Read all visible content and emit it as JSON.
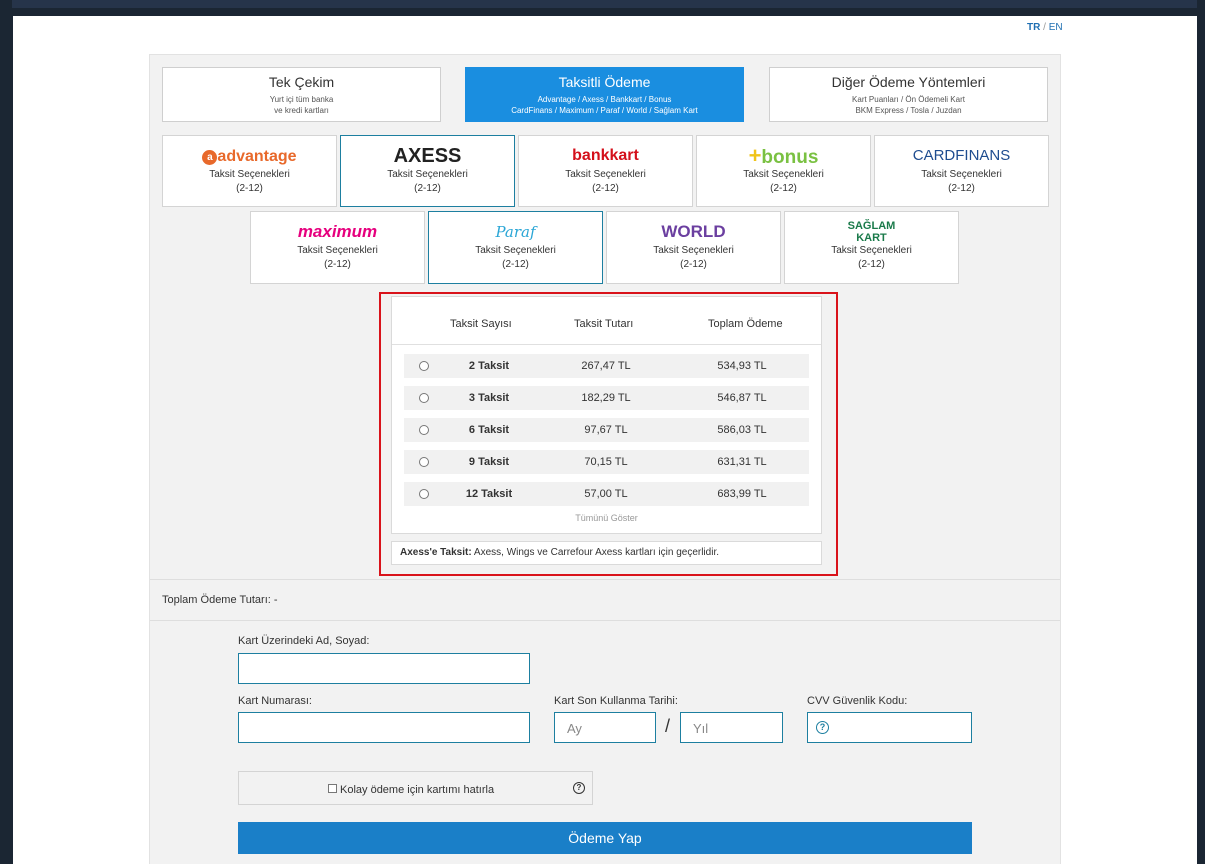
{
  "language": {
    "tr": "TR",
    "separator": "/",
    "en": "EN"
  },
  "tabs": [
    {
      "title": "Tek Çekim",
      "sub1": "Yurt içi tüm banka",
      "sub2": "ve kredi kartları"
    },
    {
      "title": "Taksitli Ödeme",
      "sub1": "Advantage / Axess / Bankkart / Bonus",
      "sub2": "CardFinans / Maximum / Paraf / World / Sağlam Kart"
    },
    {
      "title": "Diğer Ödeme Yöntemleri",
      "sub1": "Kart Puanları / Ön Ödemeli Kart",
      "sub2": "BKM Express / Tosla / Juzdan"
    }
  ],
  "cards": [
    {
      "logo": "advantage",
      "color": "#e8692b",
      "label": "Taksit Seçenekleri",
      "range": "(2-12)"
    },
    {
      "logo": "AXESS",
      "color": "#222222",
      "label": "Taksit Seçenekleri",
      "range": "(2-12)"
    },
    {
      "logo": "bankkart",
      "color": "#d4101b",
      "label": "Taksit Seçenekleri",
      "range": "(2-12)"
    },
    {
      "logo": "bonus",
      "color": "#7ac142",
      "label": "Taksit Seçenekleri",
      "range": "(2-12)"
    },
    {
      "logo": "CARDFINANS",
      "color": "#1e4c8f",
      "label": "Taksit Seçenekleri",
      "range": "(2-12)"
    },
    {
      "logo": "maximum",
      "color": "#e6007e",
      "label": "Taksit Seçenekleri",
      "range": "(2-12)"
    },
    {
      "logo": "Paraf",
      "color": "#2aa6d6",
      "label": "Taksit Seçenekleri",
      "range": "(2-12)"
    },
    {
      "logo": "WORLD",
      "color": "#6b3fa0",
      "label": "Taksit Seçenekleri",
      "range": "(2-12)"
    },
    {
      "logo": "SAĞLAM KART",
      "color": "#1a7a4a",
      "label": "Taksit Seçenekleri",
      "range": "(2-12)"
    }
  ],
  "installments": {
    "headers": [
      "Taksit Sayısı",
      "Taksit Tutarı",
      "Toplam Ödeme"
    ],
    "rows": [
      {
        "count": "2 Taksit",
        "amount": "267,47 TL",
        "total": "534,93 TL"
      },
      {
        "count": "3 Taksit",
        "amount": "182,29 TL",
        "total": "546,87 TL"
      },
      {
        "count": "6 Taksit",
        "amount": "97,67 TL",
        "total": "586,03 TL"
      },
      {
        "count": "9 Taksit",
        "amount": "70,15 TL",
        "total": "631,31 TL"
      },
      {
        "count": "12 Taksit",
        "amount": "57,00 TL",
        "total": "683,99 TL"
      }
    ],
    "show_all": "Tümünü Göster",
    "note_bold": "Axess'e Taksit:",
    "note_text": " Axess, Wings ve Carrefour Axess kartları için geçerlidir."
  },
  "total": {
    "label": "Toplam Ödeme Tutarı: -"
  },
  "form": {
    "name_label": "Kart Üzerindeki Ad, Soyad:",
    "number_label": "Kart Numarası:",
    "expiry_label": "Kart Son Kullanma Tarihi:",
    "month_placeholder": "Ay",
    "expiry_separator": "/",
    "year_placeholder": "Yıl",
    "cvv_label": "CVV Güvenlik Kodu:",
    "remember_label": "Kolay ödeme için kartımı hatırla",
    "pay_button": "Ödeme Yap"
  },
  "colors": {
    "accent": "#1a8ee0",
    "highlight_border": "#d9131b",
    "input_border": "#1d7fa0"
  }
}
